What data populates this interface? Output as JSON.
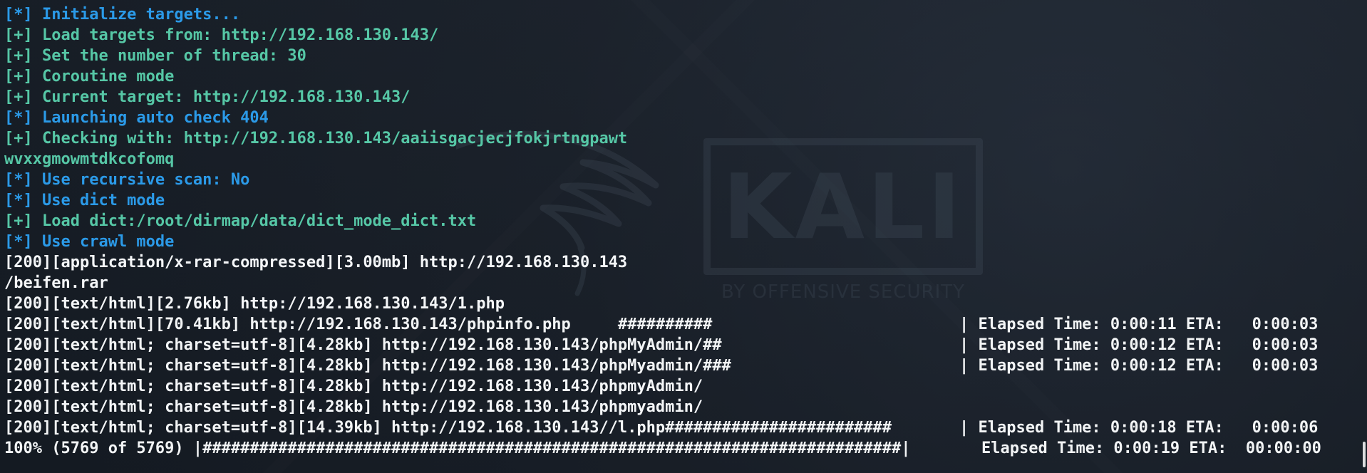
{
  "terminal": {
    "lines": {
      "l1": "[*] Initialize targets...",
      "l2": "[+] Load targets from: http://192.168.130.143/",
      "l3": "[+] Set the number of thread: 30",
      "l4": "[+] Coroutine mode",
      "l5": "[+] Current target: http://192.168.130.143/",
      "l6": "[*] Launching auto check 404",
      "l7": "[+] Checking with: http://192.168.130.143/aaiisgacjecjfokjrtngpawt",
      "l8": "wvxxgmowmtdkcofomq",
      "l9": "[*] Use recursive scan: No",
      "l10": "[*] Use dict mode",
      "l11": "[+] Load dict:/root/dirmap/data/dict_mode_dict.txt",
      "l12": "[*] Use crawl mode",
      "l13": "[200][application/x-rar-compressed][3.00mb] http://192.168.130.143",
      "l14": "/beifen.rar",
      "l15": "[200][text/html][2.76kb] http://192.168.130.143/1.php",
      "l16_left": "[200][text/html][70.41kb] http://192.168.130.143/phpinfo.php     ##########",
      "l16_right": "| Elapsed Time: 0:00:11 ETA:   0:00:03",
      "l17_left": "[200][text/html; charset=utf-8][4.28kb] http://192.168.130.143/phpMyAdmin/##",
      "l17_right": "| Elapsed Time: 0:00:12 ETA:   0:00:03",
      "l18_left": "[200][text/html; charset=utf-8][4.28kb] http://192.168.130.143/phpMyadmin/###",
      "l18_right": "| Elapsed Time: 0:00:12 ETA:   0:00:03",
      "l19": "[200][text/html; charset=utf-8][4.28kb] http://192.168.130.143/phpmyAdmin/",
      "l20": "[200][text/html; charset=utf-8][4.28kb] http://192.168.130.143/phpmyadmin/",
      "l21_left": "[200][text/html; charset=utf-8][14.39kb] http://192.168.130.143//l.php########################",
      "l21_right": "| Elapsed Time: 0:00:18 ETA:   0:00:06",
      "l22_left": "100% (5769 of 5769) |##########################################################################|",
      "l22_right": "Elapsed Time: 0:00:19 ETA:  00:00:00"
    }
  },
  "watermark": {
    "brand": "KALI",
    "tagline": "BY OFFENSIVE SECURITY"
  },
  "colors": {
    "background": "#1e2530",
    "blue": "#2b9ae8",
    "green": "#56c7a6",
    "white": "#f4f6f8"
  }
}
